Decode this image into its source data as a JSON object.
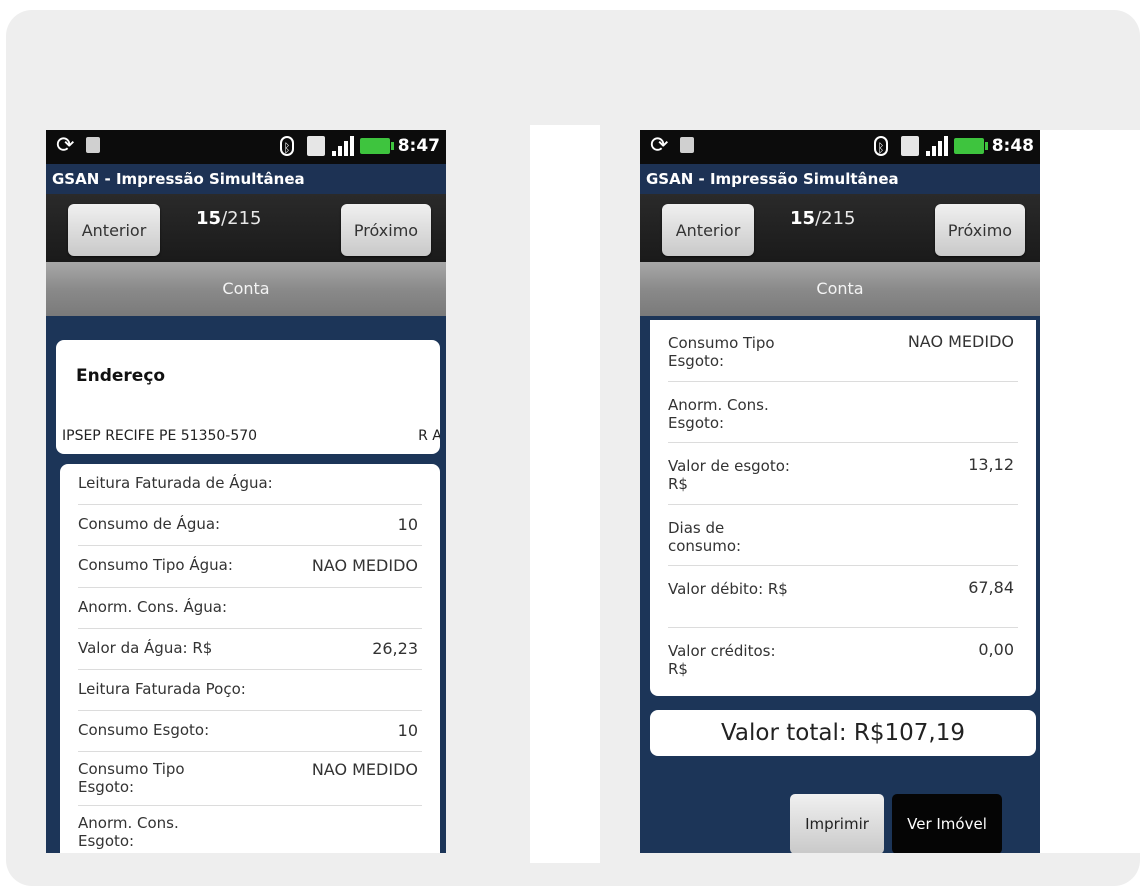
{
  "left_screen": {
    "status": {
      "time": "8:47"
    },
    "app_title": "GSAN - Impressão Simultânea",
    "nav": {
      "prev_label": "Anterior",
      "next_label": "Próximo",
      "current": "15",
      "total": "/215"
    },
    "section_title": "Conta",
    "endereco": {
      "heading": "Endereço",
      "address": "IPSEP RECIFE PE 51350-570",
      "address_cut": "R AI"
    },
    "rows": [
      {
        "label": "Leitura Faturada de Água:",
        "value": ""
      },
      {
        "label": "Consumo de Água:",
        "value": "10"
      },
      {
        "label": "Consumo Tipo Água:",
        "value": "NAO MEDIDO"
      },
      {
        "label": "Anorm. Cons. Água:",
        "value": ""
      },
      {
        "label": "Valor da Água: R$",
        "value": "26,23"
      },
      {
        "label": "Leitura Faturada Poço:",
        "value": ""
      },
      {
        "label": "Consumo Esgoto:",
        "value": "10"
      },
      {
        "label": "Consumo Tipo Esgoto:",
        "value": "NAO MEDIDO"
      },
      {
        "label": "Anorm. Cons. Esgoto:",
        "value": ""
      }
    ]
  },
  "right_screen": {
    "status": {
      "time": "8:48"
    },
    "app_title": "GSAN - Impressão Simultânea",
    "nav": {
      "prev_label": "Anterior",
      "next_label": "Próximo",
      "current": "15",
      "total": "/215"
    },
    "section_title": "Conta",
    "rows": [
      {
        "label": "Consumo Tipo Esgoto:",
        "value": "NAO MEDIDO"
      },
      {
        "label": "Anorm. Cons. Esgoto:",
        "value": ""
      },
      {
        "label": "Valor de esgoto: R$",
        "value": "13,12"
      },
      {
        "label": "Dias de consumo:",
        "value": ""
      },
      {
        "label": "Valor débito: R$",
        "value": "67,84"
      },
      {
        "label": "Valor créditos: R$",
        "value": "0,00"
      }
    ],
    "total": "Valor total: R$107,19",
    "print_label": "Imprimir",
    "ver_label": "Ver Imóvel"
  },
  "colors": {
    "background": "#1c3558",
    "status_bar": "#0c0c0c",
    "battery": "#3ec43e"
  },
  "icons": [
    "sync-icon",
    "usb-icon",
    "bluetooth-icon",
    "sd-card-icon",
    "signal-icon",
    "battery-icon"
  ]
}
